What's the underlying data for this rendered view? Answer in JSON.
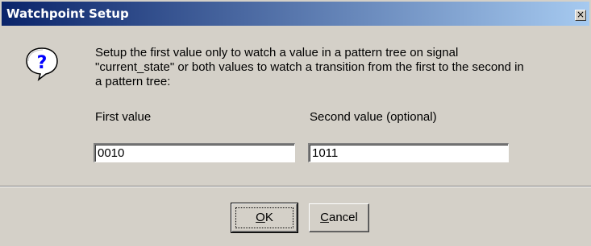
{
  "window": {
    "title": "Watchpoint Setup",
    "close_label": "×"
  },
  "icons": {
    "message_icon": "question-icon",
    "close_icon": "close-icon"
  },
  "message": {
    "line1": "Setup the first value only to watch a value in a pattern tree on signal",
    "line2": "\"current_state\" or both values to watch a transition from the first to the second in",
    "line3": "a pattern tree:"
  },
  "fields": {
    "first_label": "First value",
    "first_value": "0010",
    "second_label": "Second value (optional)",
    "second_value": "1011"
  },
  "buttons": {
    "ok_mnemonic": "O",
    "ok_rest": "K",
    "cancel_mnemonic": "C",
    "cancel_rest": "ancel"
  },
  "colors": {
    "title_start": "#0a246a",
    "title_end": "#a6caf0",
    "face": "#d4d0c8",
    "icon_blue": "#0000ff"
  }
}
